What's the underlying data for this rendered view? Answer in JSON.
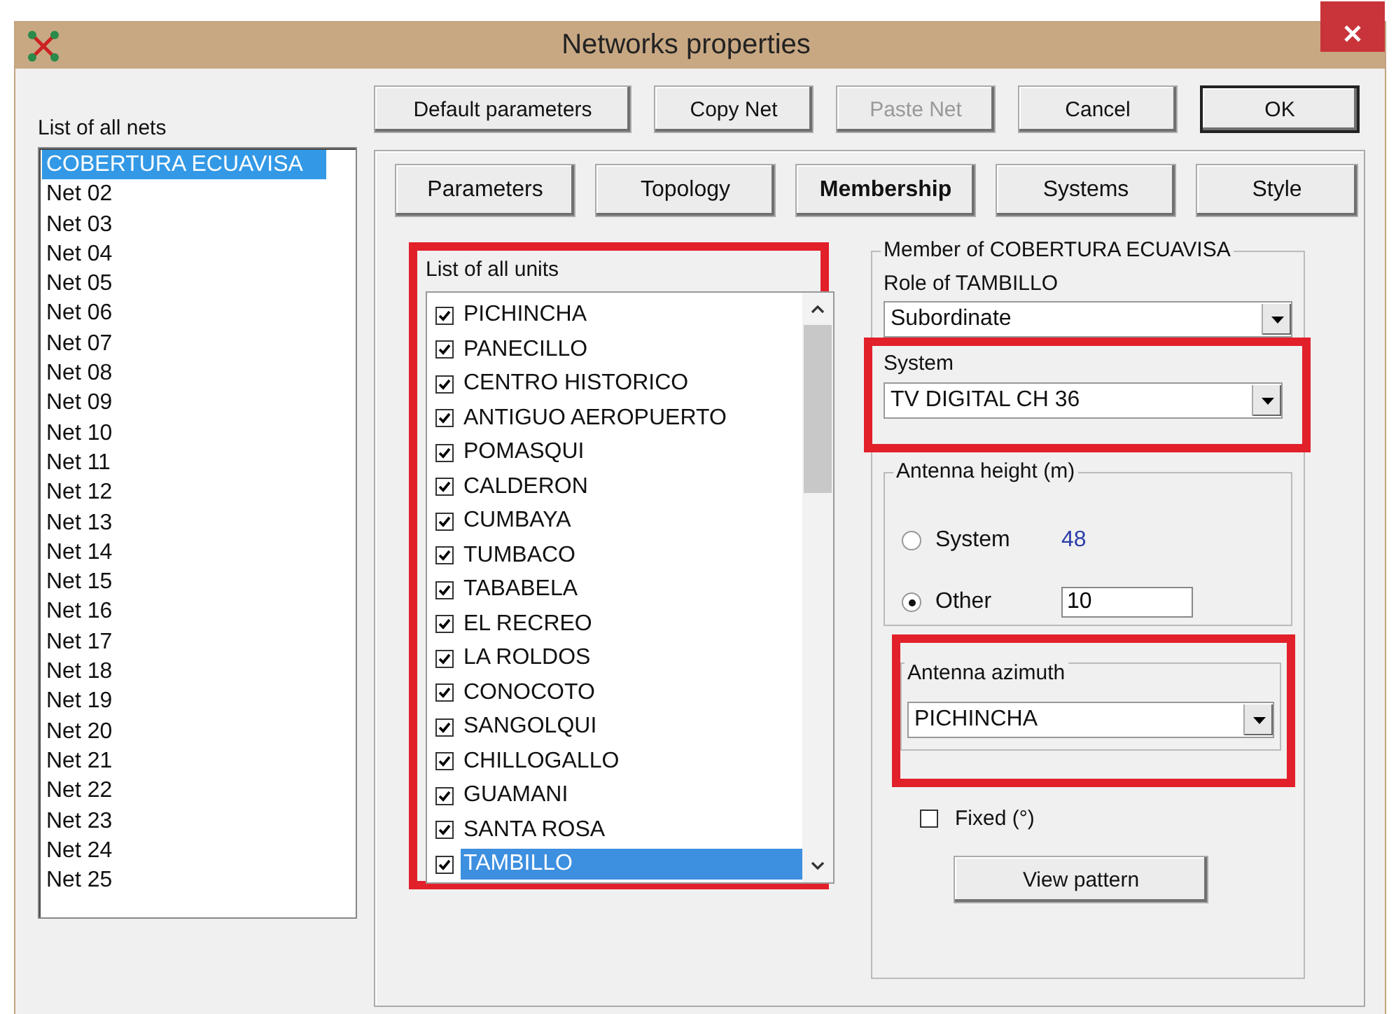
{
  "window": {
    "title": "Networks properties"
  },
  "nets_label": "List of all nets",
  "nets": [
    {
      "label": "COBERTURA ECUAVISA",
      "selected": true
    },
    {
      "label": "Net 02",
      "selected": false
    },
    {
      "label": "Net 03",
      "selected": false
    },
    {
      "label": "Net 04",
      "selected": false
    },
    {
      "label": "Net 05",
      "selected": false
    },
    {
      "label": "Net 06",
      "selected": false
    },
    {
      "label": "Net 07",
      "selected": false
    },
    {
      "label": "Net 08",
      "selected": false
    },
    {
      "label": "Net 09",
      "selected": false
    },
    {
      "label": "Net 10",
      "selected": false
    },
    {
      "label": "Net 11",
      "selected": false
    },
    {
      "label": "Net 12",
      "selected": false
    },
    {
      "label": "Net 13",
      "selected": false
    },
    {
      "label": "Net 14",
      "selected": false
    },
    {
      "label": "Net 15",
      "selected": false
    },
    {
      "label": "Net 16",
      "selected": false
    },
    {
      "label": "Net 17",
      "selected": false
    },
    {
      "label": "Net 18",
      "selected": false
    },
    {
      "label": "Net 19",
      "selected": false
    },
    {
      "label": "Net 20",
      "selected": false
    },
    {
      "label": "Net 21",
      "selected": false
    },
    {
      "label": "Net 22",
      "selected": false
    },
    {
      "label": "Net 23",
      "selected": false
    },
    {
      "label": "Net 24",
      "selected": false
    },
    {
      "label": "Net 25",
      "selected": false
    }
  ],
  "buttons": [
    {
      "label": "Default parameters",
      "disabled": false,
      "default": false
    },
    {
      "label": "Copy Net",
      "disabled": false,
      "default": false
    },
    {
      "label": "Paste Net",
      "disabled": true,
      "default": false
    },
    {
      "label": "Cancel",
      "disabled": false,
      "default": false
    },
    {
      "label": "OK",
      "disabled": false,
      "default": true
    }
  ],
  "tabs": [
    {
      "label": "Parameters",
      "selected": false
    },
    {
      "label": "Topology",
      "selected": false
    },
    {
      "label": "Membership",
      "selected": true
    },
    {
      "label": "Systems",
      "selected": false
    },
    {
      "label": "Style",
      "selected": false
    }
  ],
  "units": {
    "label": "List of all units",
    "items": [
      {
        "label": "PICHINCHA",
        "checked": true,
        "selected": false
      },
      {
        "label": "PANECILLO",
        "checked": true,
        "selected": false
      },
      {
        "label": "CENTRO HISTORICO",
        "checked": true,
        "selected": false
      },
      {
        "label": "ANTIGUO AEROPUERTO",
        "checked": true,
        "selected": false
      },
      {
        "label": "POMASQUI",
        "checked": true,
        "selected": false
      },
      {
        "label": "CALDERON",
        "checked": true,
        "selected": false
      },
      {
        "label": "CUMBAYA",
        "checked": true,
        "selected": false
      },
      {
        "label": "TUMBACO",
        "checked": true,
        "selected": false
      },
      {
        "label": "TABABELA",
        "checked": true,
        "selected": false
      },
      {
        "label": "EL RECREO",
        "checked": true,
        "selected": false
      },
      {
        "label": "LA ROLDOS",
        "checked": true,
        "selected": false
      },
      {
        "label": "CONOCOTO",
        "checked": true,
        "selected": false
      },
      {
        "label": "SANGOLQUI",
        "checked": true,
        "selected": false
      },
      {
        "label": "CHILLOGALLO",
        "checked": true,
        "selected": false
      },
      {
        "label": "GUAMANI",
        "checked": true,
        "selected": false
      },
      {
        "label": "SANTA ROSA",
        "checked": true,
        "selected": false
      },
      {
        "label": "TAMBILLO",
        "checked": true,
        "selected": true
      }
    ]
  },
  "member": {
    "title": "Member of COBERTURA ECUAVISA",
    "role_label": "Role of TAMBILLO",
    "role_value": "Subordinate",
    "system_label": "System",
    "system_value": "TV DIGITAL CH 36",
    "antenna_height": {
      "title": "Antenna height (m)",
      "options": [
        {
          "label": "System",
          "selected": false,
          "kind": "reading",
          "value": "48"
        },
        {
          "label": "Other",
          "selected": true,
          "kind": "input",
          "value": "10"
        }
      ]
    },
    "azimuth": {
      "title": "Antenna azimuth",
      "value": "PICHINCHA"
    },
    "fixed": {
      "label": "Fixed (°)",
      "checked": false
    },
    "view_button": "View pattern"
  }
}
